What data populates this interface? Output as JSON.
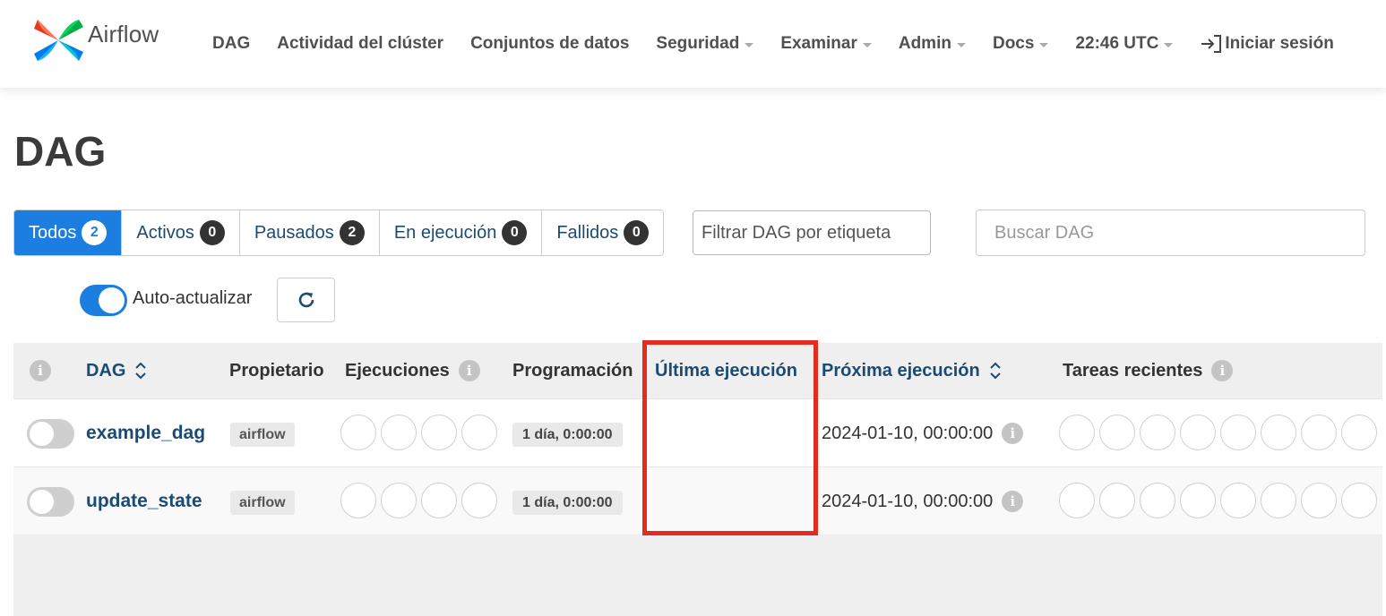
{
  "brand": {
    "name": "Airflow"
  },
  "nav": {
    "items": [
      {
        "label": "DAG",
        "dropdown": false
      },
      {
        "label": "Actividad del clúster",
        "dropdown": false
      },
      {
        "label": "Conjuntos de datos",
        "dropdown": false
      },
      {
        "label": "Seguridad",
        "dropdown": true
      },
      {
        "label": "Examinar",
        "dropdown": true
      },
      {
        "label": "Admin",
        "dropdown": true
      },
      {
        "label": "Docs",
        "dropdown": true
      },
      {
        "label": "22:46 UTC",
        "dropdown": true
      }
    ],
    "login_label": "Iniciar sesión"
  },
  "page": {
    "title": "DAG"
  },
  "status_filters": [
    {
      "label": "Todos",
      "count": "2",
      "active": true
    },
    {
      "label": "Activos",
      "count": "0",
      "active": false
    },
    {
      "label": "Pausados",
      "count": "2",
      "active": false
    },
    {
      "label": "En ejecución",
      "count": "0",
      "active": false
    },
    {
      "label": "Fallidos",
      "count": "0",
      "active": false
    }
  ],
  "filters": {
    "tag_placeholder": "Filtrar DAG por etiqueta",
    "search_placeholder": "Buscar DAG"
  },
  "auto_refresh": {
    "label": "Auto-actualizar",
    "enabled": true
  },
  "table": {
    "headers": {
      "dag": "DAG",
      "owner": "Propietario",
      "runs": "Ejecuciones",
      "schedule": "Programación",
      "last_run": "Última ejecución",
      "next_run": "Próxima ejecución",
      "recent_tasks": "Tareas recientes"
    },
    "rows": [
      {
        "dag_id": "example_dag",
        "owner": "airflow",
        "schedule": "1 día, 0:00:00",
        "last_run": "",
        "next_run": "2024-01-10, 00:00:00",
        "paused": true
      },
      {
        "dag_id": "update_state",
        "owner": "airflow",
        "schedule": "1 día, 0:00:00",
        "last_run": "",
        "next_run": "2024-01-10, 00:00:00",
        "paused": true
      }
    ]
  },
  "colors": {
    "accent": "#1b7ee0",
    "link": "#1b4b75",
    "highlight": "#e32b20"
  }
}
